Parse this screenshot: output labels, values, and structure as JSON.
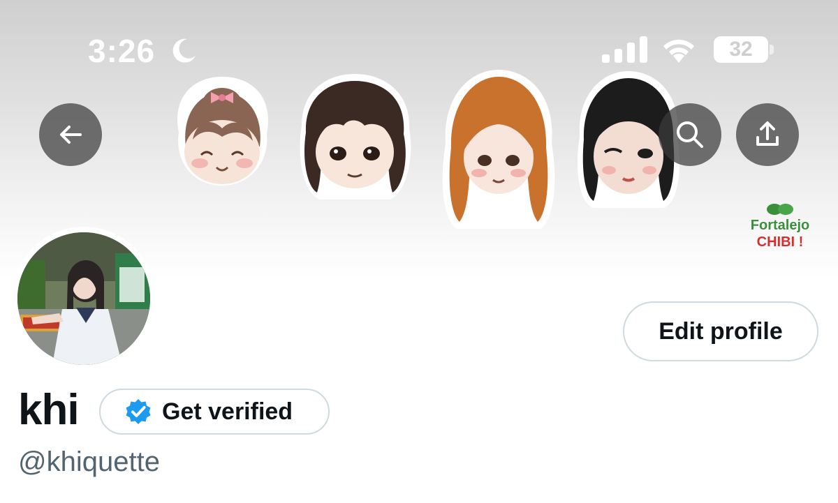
{
  "status_bar": {
    "time": "3:26",
    "battery": "32",
    "battery_level": 0.32
  },
  "header": {
    "back_icon": "arrow-left-icon",
    "search_icon": "search-icon",
    "share_icon": "share-icon"
  },
  "banner": {
    "brand_line1": "Fortalejo",
    "brand_line2": "CHIBI !"
  },
  "profile": {
    "edit_label": "Edit profile",
    "name": "khi",
    "verify_label": "Get verified",
    "handle": "@khiquette"
  },
  "colors": {
    "accent": "#1d9bf0",
    "text": "#0f1419",
    "muted": "#536471",
    "border": "#cfd9de"
  }
}
